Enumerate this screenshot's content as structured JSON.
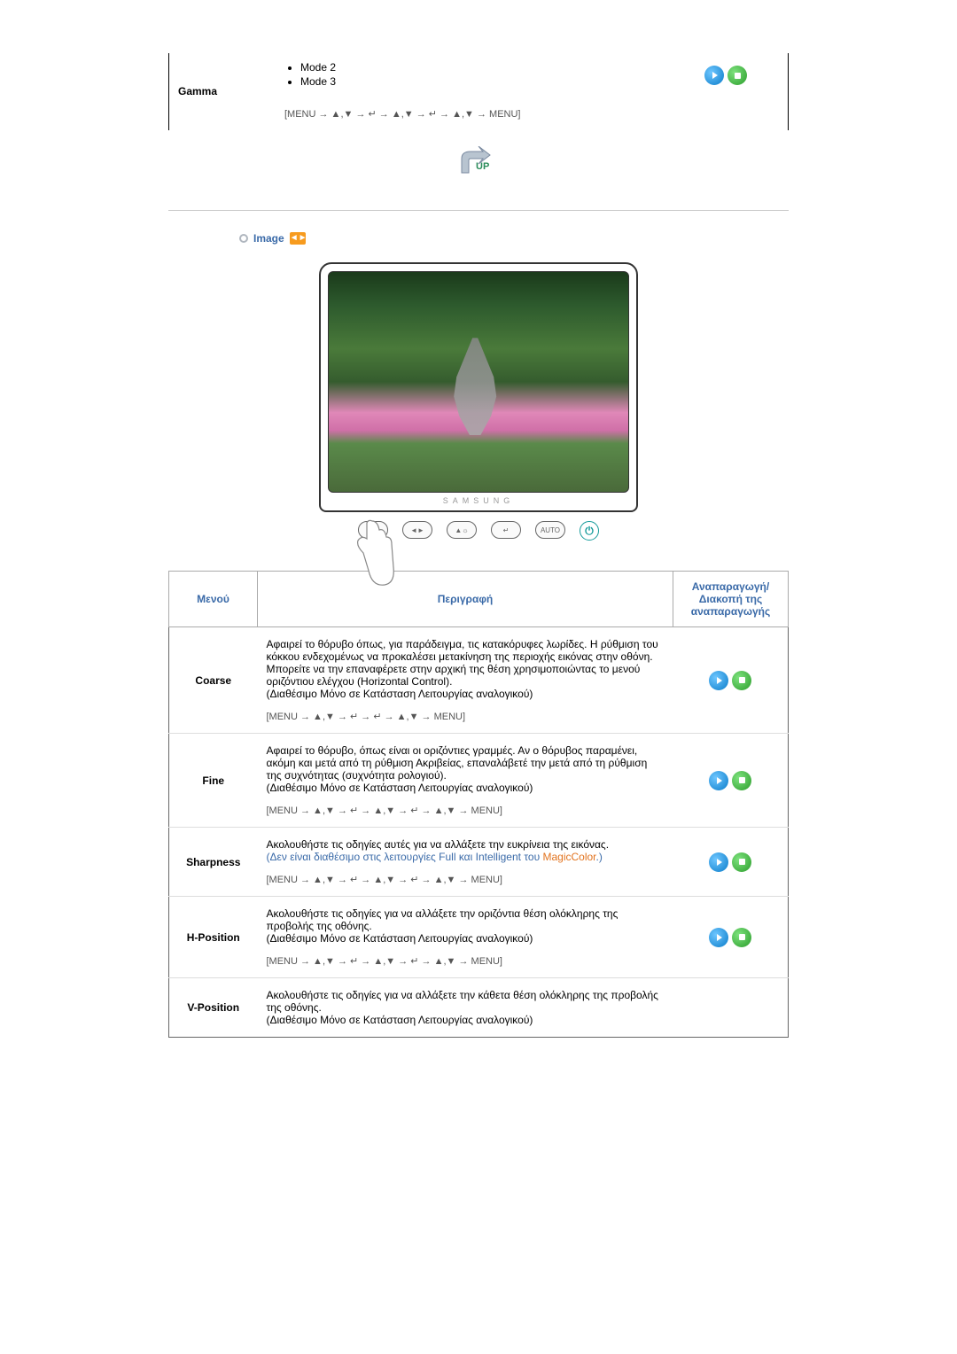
{
  "gamma": {
    "label": "Gamma",
    "modes": [
      "Mode 2",
      "Mode 3"
    ],
    "path": "[MENU → ▲,▼ → ↵ → ▲,▼ → ↵ → ▲,▼ → MENU]"
  },
  "upLabel": "UP",
  "section": {
    "title": "Image"
  },
  "monitorBrand": "SAMSUNG",
  "controls": {
    "auto": "AUTO",
    "enter": "↵",
    "power": "⏻"
  },
  "table": {
    "headers": {
      "menu": "Μενού",
      "desc": "Περιγραφή",
      "play": "Αναπαραγωγή/Διακοπή της αναπαραγωγής"
    },
    "rows": [
      {
        "menu": "Coarse",
        "desc": "Αφαιρεί το θόρυβο όπως, για παράδειγμα, τις κατακόρυφες λωρίδες. Η ρύθμιση του κόκκου ενδεχομένως να προκαλέσει μετακίνηση της περιοχής εικόνας στην οθόνη. Μπορείτε να την επαναφέρετε στην αρχική της θέση χρησιμοποιώντας το μενού οριζόντιου ελέγχου (Horizontal Control).",
        "note": "(Διαθέσιμο Μόνο σε Κατάσταση Λειτουργίας αναλογικού)",
        "path": "[MENU → ▲,▼ → ↵ → ↵ → ▲,▼ → MENU]"
      },
      {
        "menu": "Fine",
        "desc": "Αφαιρεί το θόρυβο, όπως είναι οι οριζόντιες γραμμές. Αν ο θόρυβος παραμένει, ακόμη και μετά από τη ρύθμιση Ακριβείας, επαναλάβετέ την μετά από τη ρύθμιση της συχνότητας (συχνότητα ρολογιού).",
        "note": "(Διαθέσιμο Μόνο σε Κατάσταση Λειτουργίας αναλογικού)",
        "path": "[MENU → ▲,▼ → ↵ → ▲,▼ → ↵ → ▲,▼ → MENU]"
      },
      {
        "menu": "Sharpness",
        "desc": "Ακολουθήστε τις οδηγίες αυτές για να αλλάξετε την ευκρίνεια της εικόνας.",
        "extraPrefix": "(Δεν είναι διαθέσιμο στις λειτουργίες Full και Intelligent του ",
        "extraLink": "MagicColor",
        "extraSuffix": ".)",
        "path": "[MENU → ▲,▼ → ↵ → ▲,▼ → ↵ → ▲,▼ → MENU]"
      },
      {
        "menu": "H-Position",
        "desc": "Ακολουθήστε τις οδηγίες για να αλλάξετε την οριζόντια θέση ολόκληρης της προβολής της οθόνης.",
        "note": "(Διαθέσιμο Μόνο σε Κατάσταση Λειτουργίας αναλογικού)",
        "path": "[MENU → ▲,▼ → ↵ → ▲,▼ → ↵ → ▲,▼ → MENU]"
      },
      {
        "menu": "V-Position",
        "desc": "Ακολουθήστε τις οδηγίες για να αλλάξετε την κάθετα θέση ολόκληρης της προβολής της οθόνης.",
        "note": "(Διαθέσιμο Μόνο σε Κατάσταση Λειτουργίας αναλογικού)"
      }
    ]
  }
}
